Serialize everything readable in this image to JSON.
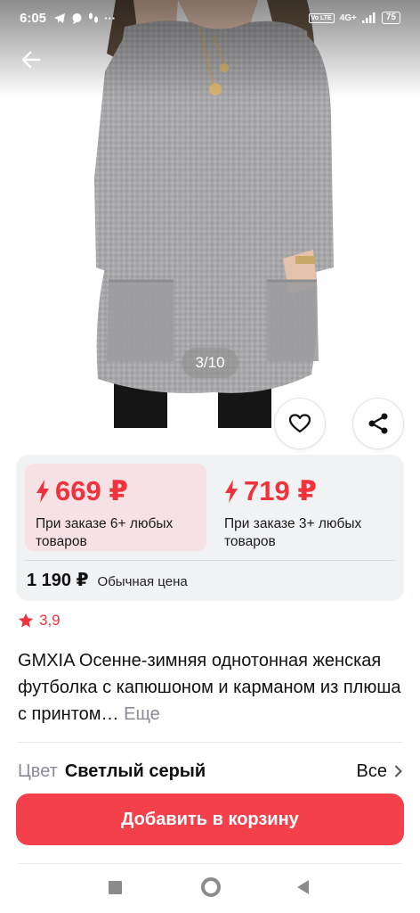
{
  "status_bar": {
    "time": "6:05",
    "network_badge": "Vo LTE",
    "network_type": "4G+",
    "battery": "75"
  },
  "gallery": {
    "counter": "3/10"
  },
  "prices": {
    "offer_1": {
      "price": "669 ₽",
      "condition": "При заказе 6+ любых товаров"
    },
    "offer_2": {
      "price": "719 ₽",
      "condition": "При заказе 3+ любых товаров"
    },
    "regular_price": "1 190 ₽",
    "regular_label": "Обычная цена"
  },
  "product": {
    "rating": "3,9",
    "title": "GMXIA Осенне-зимняя однотонная женская футболка с капюшоном и карманом из плюша с принтом…",
    "more_label": "Еще"
  },
  "color_option": {
    "label": "Цвет",
    "value": "Светлый серый",
    "all_label": "Все"
  },
  "cart": {
    "button_label": "Добавить в корзину"
  },
  "colors": {
    "accent": "#f0323c",
    "offer_highlight": "#f6e2e5",
    "card_bg": "#f1f2f4",
    "cart_button": "#f3404a",
    "sweater_gray": "#a9a9ab"
  },
  "icons": [
    "back-arrow-icon",
    "telegram-icon",
    "chat-icon",
    "footprints-icon",
    "more-dots-icon",
    "signal-icon",
    "battery-icon",
    "heart-icon",
    "share-icon",
    "lightning-icon",
    "star-icon",
    "chevron-right-icon"
  ]
}
